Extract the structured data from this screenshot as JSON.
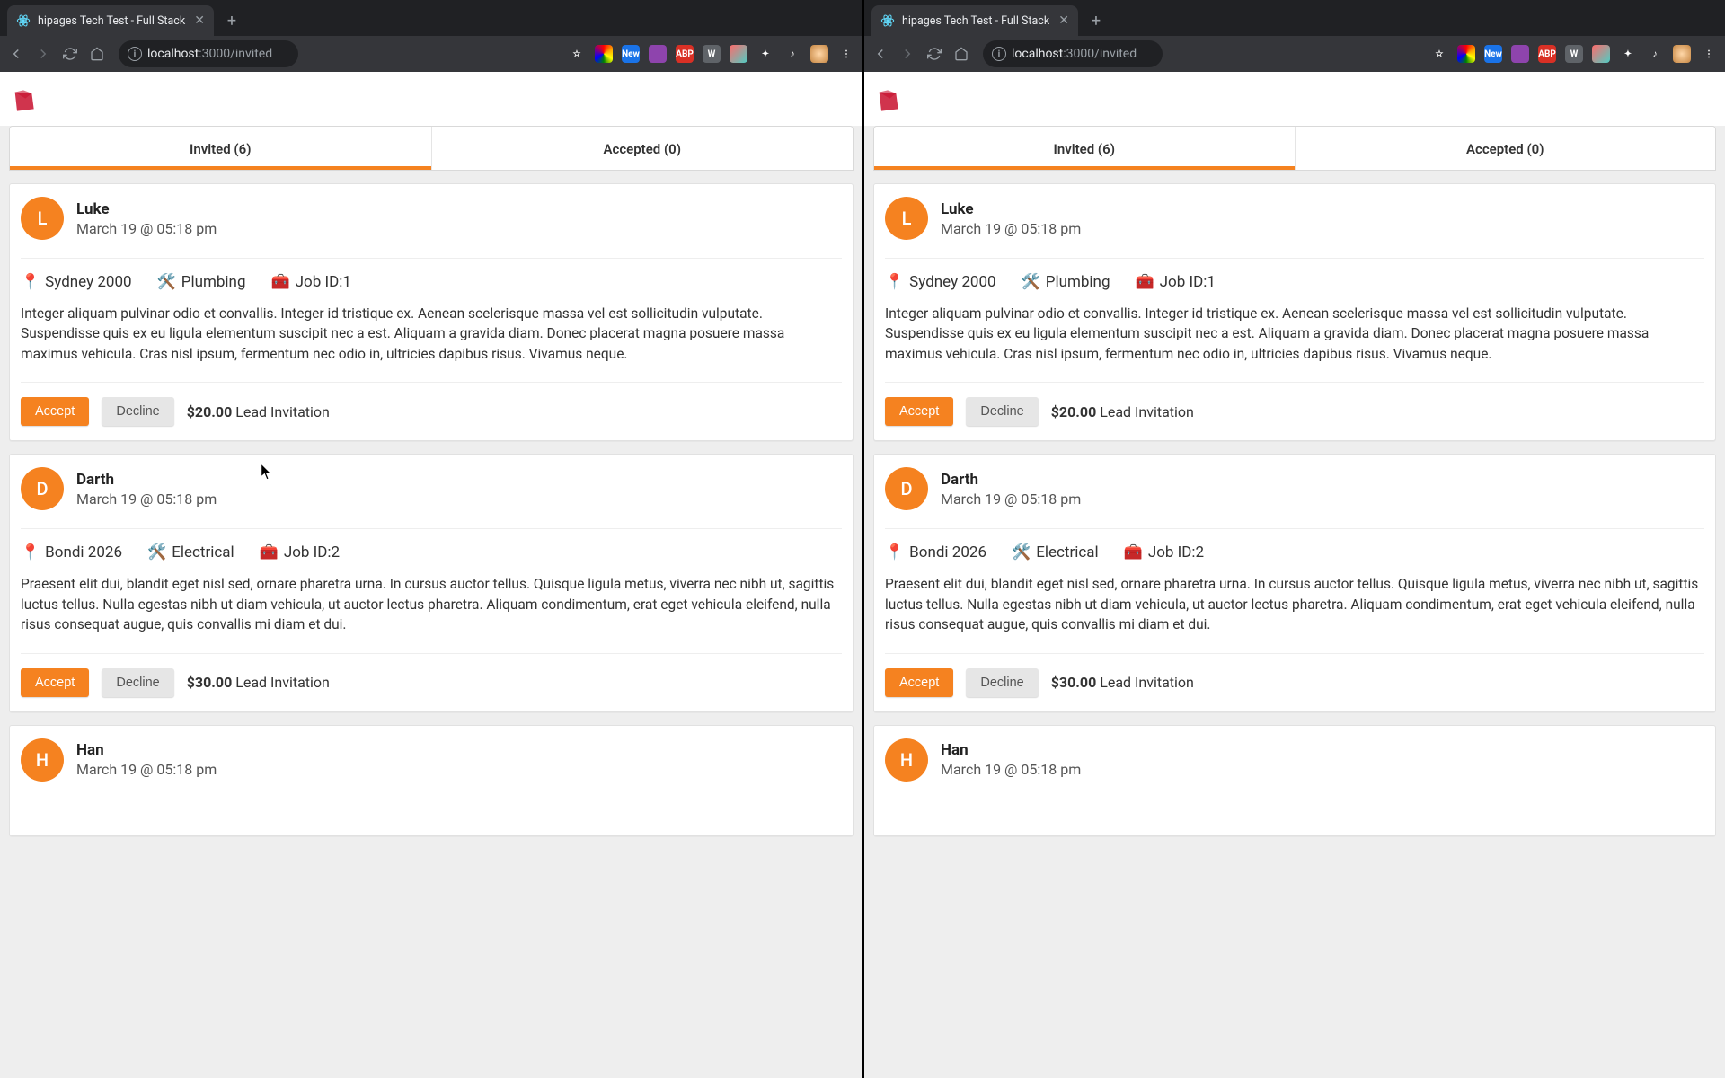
{
  "browser": {
    "tab_title": "hipages Tech Test - Full Stack",
    "url_host": "localhost",
    "url_port": ":3000",
    "url_path": "/invited",
    "ext_new_label": "New",
    "ext_abp_label": "ABP"
  },
  "tabs": {
    "invited_label": "Invited (6)",
    "accepted_label": "Accepted (0)"
  },
  "icons": {
    "pin": "📍",
    "tools": "🛠️",
    "briefcase": "🧰"
  },
  "leads": [
    {
      "initial": "L",
      "name": "Luke",
      "when": "March 19 @ 05:18 pm",
      "location": "Sydney 2000",
      "category": "Plumbing",
      "job_id": "Job ID:1",
      "desc": "Integer aliquam pulvinar odio et convallis. Integer id tristique ex. Aenean scelerisque massa vel est sollicitudin vulputate. Suspendisse quis ex eu ligula elementum suscipit nec a est. Aliquam a gravida diam. Donec placerat magna posuere massa maximus vehicula. Cras nisl ipsum, fermentum nec odio in, ultricies dapibus risus. Vivamus neque.",
      "price": "$20.00",
      "price_label": "Lead Invitation",
      "accept": "Accept",
      "decline": "Decline"
    },
    {
      "initial": "D",
      "name": "Darth",
      "when": "March 19 @ 05:18 pm",
      "location": "Bondi 2026",
      "category": "Electrical",
      "job_id": "Job ID:2",
      "desc": "Praesent elit dui, blandit eget nisl sed, ornare pharetra urna. In cursus auctor tellus. Quisque ligula metus, viverra nec nibh ut, sagittis luctus tellus. Nulla egestas nibh ut diam vehicula, ut auctor lectus pharetra. Aliquam condimentum, erat eget vehicula eleifend, nulla risus consequat augue, quis convallis mi diam et dui.",
      "price": "$30.00",
      "price_label": "Lead Invitation",
      "accept": "Accept",
      "decline": "Decline"
    },
    {
      "initial": "H",
      "name": "Han",
      "when": "March 19 @ 05:18 pm",
      "location": "",
      "category": "",
      "job_id": "",
      "desc": "",
      "price": "",
      "price_label": "",
      "accept": "",
      "decline": ""
    }
  ]
}
